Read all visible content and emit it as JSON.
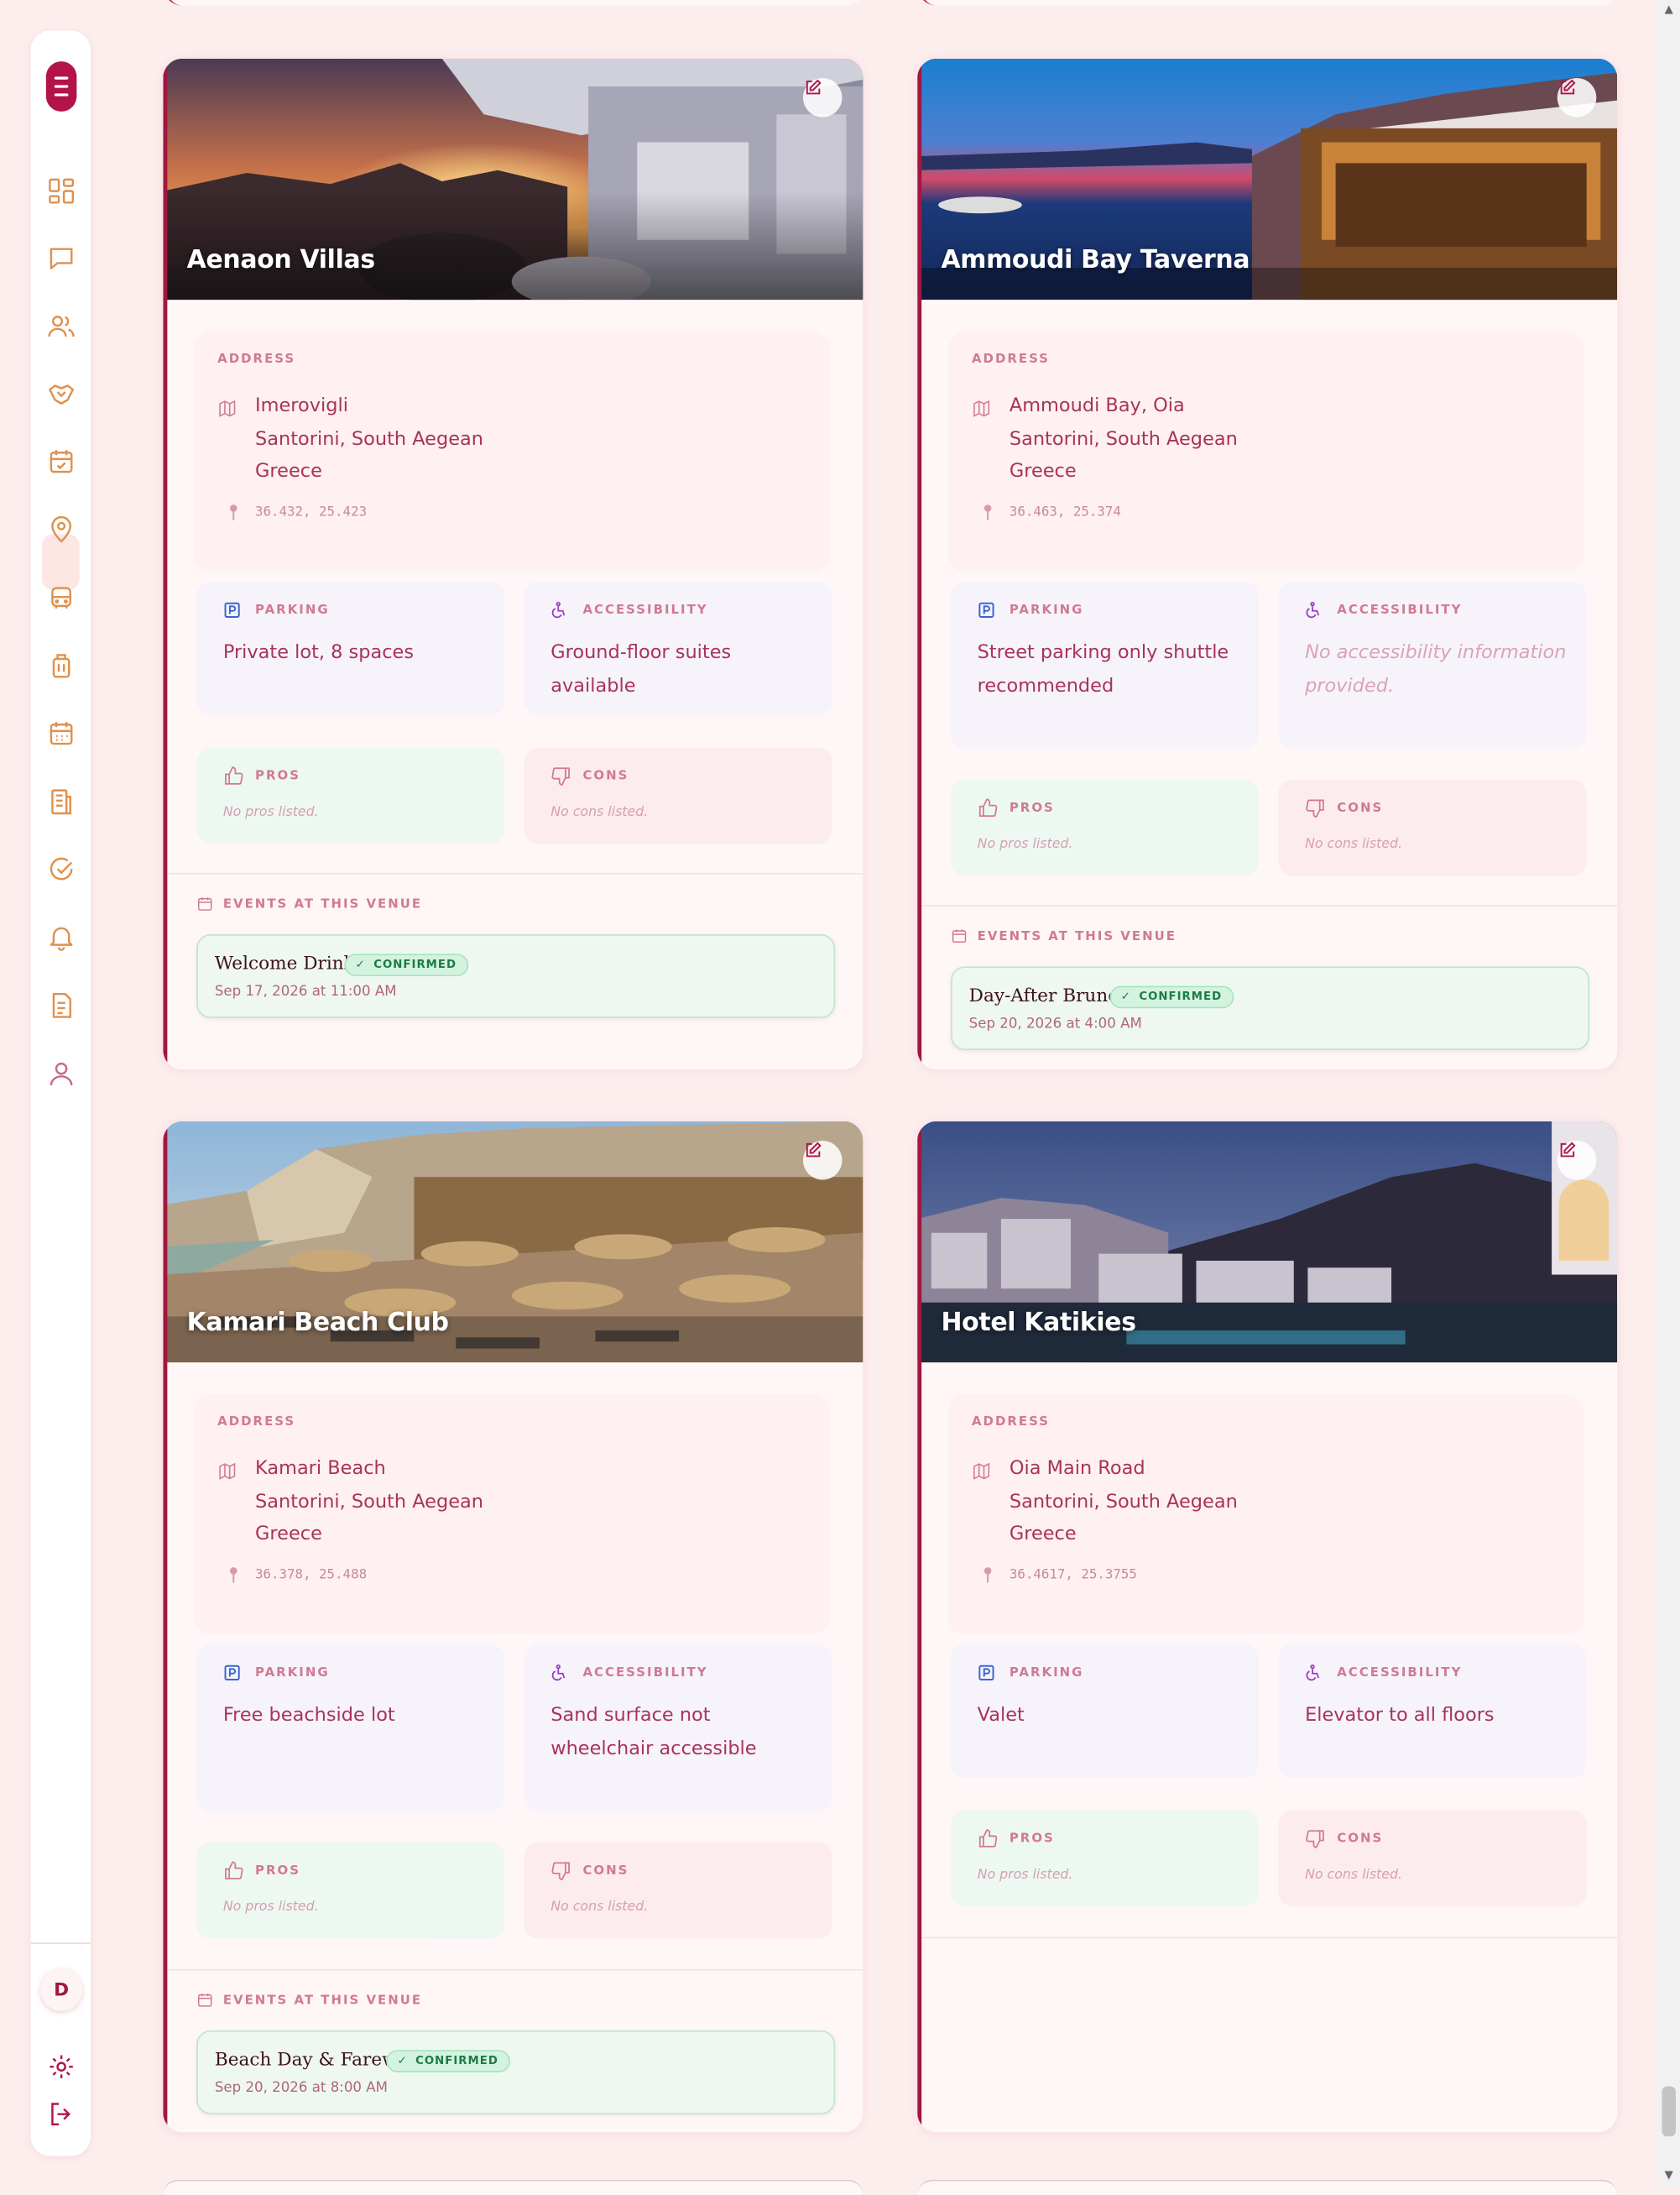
{
  "labels": {
    "address": "ADDRESS",
    "parking": "PARKING",
    "accessibility": "ACCESSIBILITY",
    "pros": "PROS",
    "cons": "CONS",
    "events": "EVENTS AT THIS VENUE"
  },
  "sidebar": {
    "avatar_initial": "D",
    "nav_icons": [
      "dashboard-icon",
      "messages-icon",
      "guests-icon",
      "vendors-icon",
      "events-icon",
      "venues-icon",
      "travel-icon",
      "luggage-icon",
      "calendar-icon",
      "documents-icon",
      "tasks-icon",
      "notifications-icon",
      "notes-icon",
      "profile-icon"
    ],
    "active": "venues-icon"
  },
  "colors": {
    "accent": "#a0173f",
    "background": "#fdeeee"
  },
  "venues": [
    {
      "name": "Aenaon Villas",
      "address": [
        "Imerovigli",
        "Santorini, South Aegean",
        "Greece"
      ],
      "coords": "36.432, 25.423",
      "parking": "Private lot, 8 spaces",
      "accessibility": "Ground-floor suites available",
      "pros": "No pros listed.",
      "cons": "No cons listed.",
      "events": [
        {
          "title": "Welcome Drinks",
          "status": "CONFIRMED",
          "date": "Sep 17, 2026 at 11:00 AM"
        }
      ]
    },
    {
      "name": "Ammoudi Bay Taverna",
      "address": [
        "Ammoudi Bay, Oia",
        "Santorini, South Aegean",
        "Greece"
      ],
      "coords": "36.463, 25.374",
      "parking": "Street parking only shuttle recommended",
      "accessibility": "No accessibility information provided.",
      "pros": "No pros listed.",
      "cons": "No cons listed.",
      "events": [
        {
          "title": "Day-After Brunch",
          "status": "CONFIRMED",
          "date": "Sep 20, 2026 at 4:00 AM"
        }
      ]
    },
    {
      "name": "Kamari Beach Club",
      "address": [
        "Kamari Beach",
        "Santorini, South Aegean",
        "Greece"
      ],
      "coords": "36.378, 25.488",
      "parking": "Free beachside lot",
      "accessibility": "Sand surface not wheelchair accessible",
      "pros": "No pros listed.",
      "cons": "No cons listed.",
      "events": [
        {
          "title": "Beach Day & Farewell",
          "status": "CONFIRMED",
          "date": "Sep 20, 2026 at 8:00 AM"
        }
      ]
    },
    {
      "name": "Hotel Katikies",
      "address": [
        "Oia Main Road",
        "Santorini, South Aegean",
        "Greece"
      ],
      "coords": "36.4617, 25.3755",
      "parking": "Valet",
      "accessibility": "Elevator to all floors",
      "pros": "No pros listed.",
      "cons": "No cons listed.",
      "events": []
    }
  ]
}
